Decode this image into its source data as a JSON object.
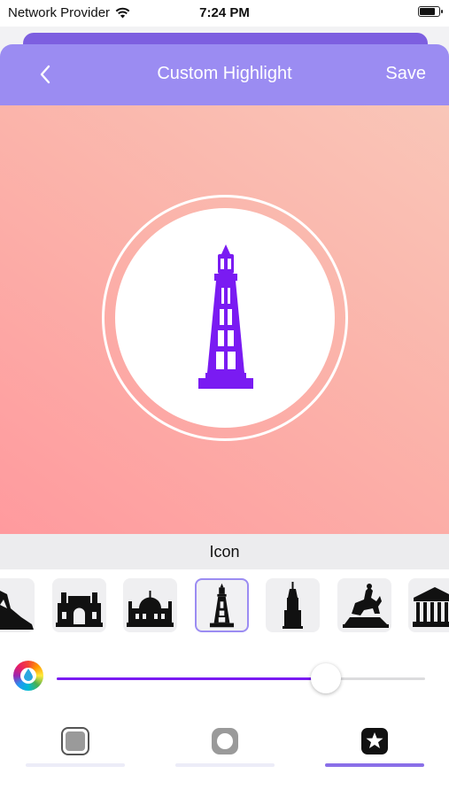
{
  "status": {
    "carrier": "Network Provider",
    "time": "7:24 PM",
    "battery_level": 0.85
  },
  "nav": {
    "title": "Custom Highlight",
    "save_label": "Save"
  },
  "preview": {
    "icon_color": "#7a1bf2",
    "gradient": [
      "#ff9a9e",
      "#f9c6b8"
    ],
    "ring_color": "#ffffff"
  },
  "section": {
    "title": "Icon"
  },
  "icons": [
    {
      "name": "rock-landmark-icon",
      "selected": false
    },
    {
      "name": "gateway-of-india-icon",
      "selected": false
    },
    {
      "name": "mosque-icon",
      "selected": false
    },
    {
      "name": "blackpool-tower-icon",
      "selected": true
    },
    {
      "name": "skyscraper-icon",
      "selected": false
    },
    {
      "name": "horse-statue-icon",
      "selected": false
    },
    {
      "name": "classical-building-icon",
      "selected": false
    }
  ],
  "color": {
    "slider_value": 0.73,
    "accent": "#7a1bf2"
  },
  "tabs": [
    {
      "name": "tab-background",
      "icon": "rounded-square-icon",
      "active": false
    },
    {
      "name": "tab-border",
      "icon": "ring-icon",
      "active": false
    },
    {
      "name": "tab-icon",
      "icon": "star-badge-icon",
      "active": true
    }
  ]
}
